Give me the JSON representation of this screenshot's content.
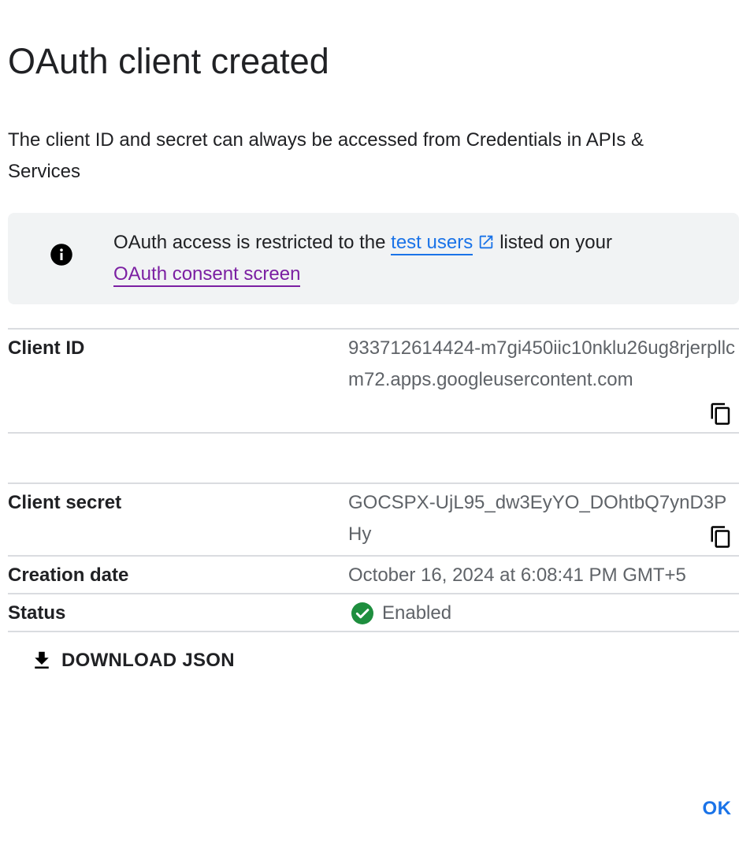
{
  "dialog": {
    "title": "OAuth client created",
    "subtitle": "The client ID and secret can always be accessed from Credentials in APIs & Services"
  },
  "banner": {
    "icon": "info-icon",
    "text_before": "OAuth access is restricted to the ",
    "test_users_link": "test users",
    "external_icon": "open-in-new-icon",
    "text_after": "listed on your",
    "consent_link": "OAuth consent screen"
  },
  "details": {
    "client_id": {
      "label": "Client ID",
      "value": "933712614424-m7gi450iic10nklu26ug8rjerpllcm72.apps.googleusercontent.com",
      "copy_icon": "copy-icon"
    },
    "client_secret": {
      "label": "Client secret",
      "value": "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",
      "copy_icon": "copy-icon"
    },
    "creation_date": {
      "label": "Creation date",
      "value": "October 16, 2024 at 6:08:41 PM GMT+5"
    },
    "status": {
      "label": "Status",
      "value": "Enabled",
      "icon": "check-circle-icon",
      "color": "#1e8e3e"
    }
  },
  "actions": {
    "download_label": "DOWNLOAD JSON",
    "download_icon": "download-icon",
    "ok_label": "OK"
  },
  "colors": {
    "link_blue": "#1a73e8",
    "link_visited": "#7b1fa2",
    "banner_bg": "#f1f3f4",
    "divider": "#dadce0"
  }
}
